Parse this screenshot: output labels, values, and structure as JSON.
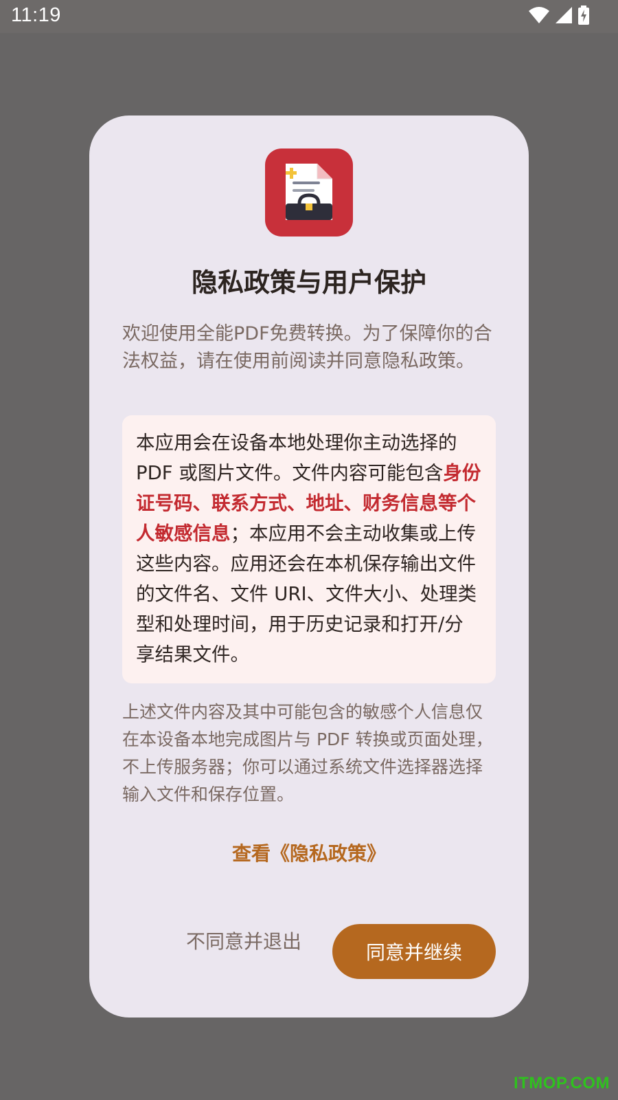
{
  "status_bar": {
    "time": "11:19",
    "icons": [
      "wifi-icon",
      "cellular-signal-icon",
      "battery-charging-icon"
    ]
  },
  "dialog": {
    "app_icon": "pdf-converter-app-icon",
    "title": "隐私政策与用户保护",
    "intro": "欢迎使用全能PDF免费转换。为了保障你的合法权益，请在使用前阅读并同意隐私政策。",
    "notice": {
      "part1": "本应用会在设备本地处理你主动选择的PDF 或图片文件。文件内容可能包含",
      "highlight": "身份证号码、联系方式、地址、财务信息等个人敏感信息",
      "part2": "；本应用不会主动收集或上传这些内容。应用还会在本机保存输出文件的文件名、文件 URI、文件大小、处理类型和处理时间，用于历史记录和打开/分享结果文件。"
    },
    "local_processing": "上述文件内容及其中可能包含的敏感个人信息仅在本设备本地完成图片与 PDF 转换或页面处理，不上传服务器；你可以通过系统文件选择器选择输入文件和保存位置。",
    "policy_link": "查看《隐私政策》",
    "decline_label": "不同意并退出",
    "agree_label": "同意并继续"
  },
  "watermark": "ITMOP.COM",
  "colors": {
    "accent": "#b5681f",
    "highlight": "#c32a30",
    "icon_bg": "#c8303a",
    "dialog_bg": "#ebe6ef",
    "notice_bg": "#fdf1f0"
  }
}
